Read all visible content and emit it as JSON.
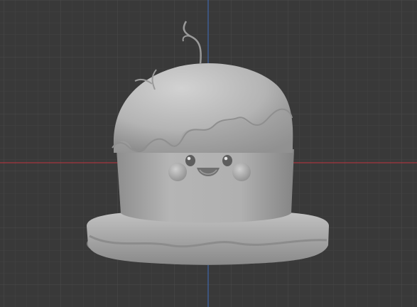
{
  "viewport": {
    "background_color": "#393939",
    "grid_minor_color": "#424242",
    "grid_major_color": "#4b4b4b",
    "x_axis_color": "#c0343f",
    "y_axis_color": "#3f6fc0",
    "model_color": "#b9b9b9"
  },
  "model": {
    "name": "cake-mascot-icon",
    "features": [
      "sprout-icon",
      "frosting-drip",
      "face-eyes",
      "face-smile",
      "blush-cheeks",
      "saucer-plate"
    ]
  }
}
